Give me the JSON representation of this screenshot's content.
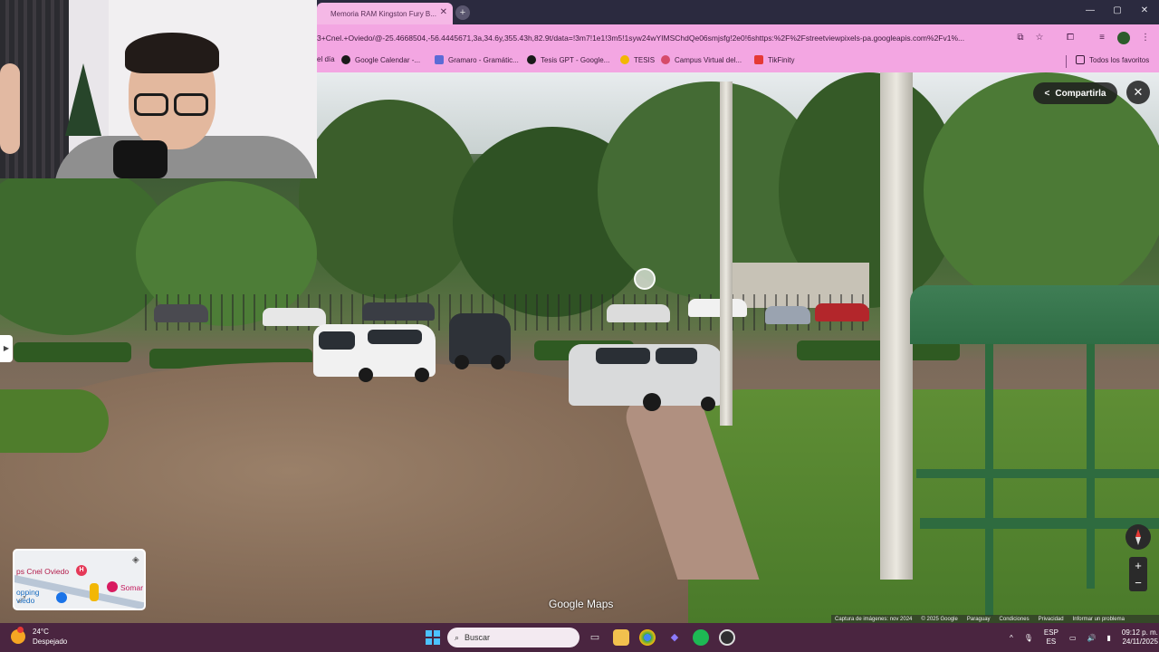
{
  "browser": {
    "tab_title": "Memoria RAM Kingston Fury B...",
    "new_tab_symbol": "+",
    "window_controls": {
      "minimize": "—",
      "maximize": "▢",
      "close": "✕"
    },
    "url": "3+Cnel.+Oviedo/@-25.4668504,-56.4445671,3a,34.6y,355.43h,82.9t/data=!3m7!1e1!3m5!1syw24wYIMSChdQe06smjsfg!2e0!6shttps:%2F%2Fstreetviewpixels-pa.googleapis.com%2Fv1%...",
    "bookmarks": [
      {
        "label": "el día",
        "color": "#888888"
      },
      {
        "label": "Google Calendar -...",
        "color": "#1a1a1a"
      },
      {
        "label": "Gramaro - Gramátic...",
        "color": "#5b6bd6"
      },
      {
        "label": "Tesis GPT - Google...",
        "color": "#1a1a1a"
      },
      {
        "label": "TESIS",
        "color": "#f2b705"
      },
      {
        "label": "Campus Virtual del...",
        "color": "#d64b6a"
      },
      {
        "label": "TikFinity",
        "color": "#e53935"
      }
    ],
    "all_bookmarks": "Todos los favoritos"
  },
  "maps": {
    "share_label": "Compartirla",
    "close_symbol": "✕",
    "watermark": "Google Maps",
    "minimap": {
      "label_hospital": "ps Cnel Oviedo",
      "label_shopping": "opping\nviedo",
      "label_somar": "Somar",
      "pin_h": "H"
    },
    "zoom_in": "+",
    "zoom_out": "−",
    "attribution": [
      "Captura de imágenes: nov 2024",
      "© 2025 Google",
      "Paraguay",
      "Condiciones",
      "Privacidad",
      "Informar un problema"
    ]
  },
  "taskbar": {
    "temperature": "24°C",
    "weather": "Despejado",
    "search_placeholder": "Buscar",
    "language_top": "ESP",
    "language_bottom": "ES",
    "time": "09:12 p. m.",
    "date": "24/11/2025"
  },
  "colors": {
    "tabbar": "#2b2a3f",
    "addrbar": "#f3a6e2",
    "taskbar": "#4a2540"
  }
}
